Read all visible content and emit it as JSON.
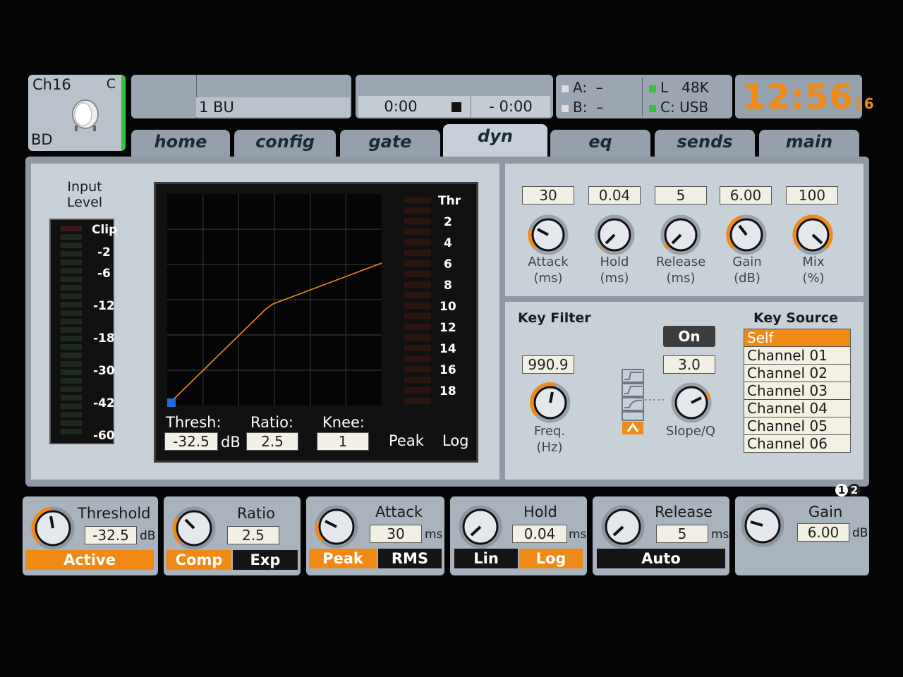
{
  "channel": {
    "name": "Ch16",
    "corner": "C",
    "short": "BD"
  },
  "header": {
    "channel_label": "1 BU",
    "time_elapsed": "0:00",
    "time_remaining": "- 0:00",
    "io": {
      "a_label": "A:",
      "a_value": "–",
      "b_label": "B:",
      "b_value": "–",
      "l_label": "L",
      "rate": "48K",
      "c_label": "C:",
      "c_value": "USB"
    },
    "clock": {
      "hm": "12:56",
      "sec": "16"
    }
  },
  "tabs": [
    "home",
    "config",
    "gate",
    "dyn",
    "eq",
    "sends",
    "main"
  ],
  "active_tab": "dyn",
  "input_meter": {
    "title_line1": "Input",
    "title_line2": "Level",
    "labels": [
      "Clip",
      "-2",
      "-6",
      "-12",
      "-18",
      "-30",
      "-42",
      "-60"
    ]
  },
  "graph": {
    "gr_labels": [
      "Thr",
      "2",
      "4",
      "6",
      "8",
      "10",
      "12",
      "14",
      "16",
      "18"
    ],
    "thresh_label": "Thresh:",
    "thresh_value": "-32.5",
    "thresh_unit": "dB",
    "ratio_label": "Ratio:",
    "ratio_value": "2.5",
    "knee_label": "Knee:",
    "knee_value": "1",
    "mode_peak": "Peak",
    "mode_log": "Log"
  },
  "params": [
    {
      "value": "30",
      "label1": "Attack",
      "label2": "(ms)"
    },
    {
      "value": "0.04",
      "label1": "Hold",
      "label2": "(ms)"
    },
    {
      "value": "5",
      "label1": "Release",
      "label2": "(ms)"
    },
    {
      "value": "6.00",
      "label1": "Gain",
      "label2": "(dB)"
    },
    {
      "value": "100",
      "label1": "Mix",
      "label2": "(%)"
    }
  ],
  "key_filter": {
    "title": "Key Filter",
    "freq_value": "990.9",
    "freq_label1": "Freq.",
    "freq_label2": "(Hz)",
    "on_label": "On",
    "slope_value": "3.0",
    "slope_label": "Slope/Q"
  },
  "key_source": {
    "title": "Key Source",
    "items": [
      "Self",
      "Channel 01",
      "Channel 02",
      "Channel 03",
      "Channel 04",
      "Channel 05",
      "Channel 06"
    ]
  },
  "page_indicator": [
    "1",
    "2"
  ],
  "bottom": {
    "threshold": {
      "label": "Threshold",
      "value": "-32.5",
      "unit": "dB",
      "button": "Active"
    },
    "ratio": {
      "label": "Ratio",
      "value": "2.5",
      "btn_a": "Comp",
      "btn_b": "Exp"
    },
    "attack": {
      "label": "Attack",
      "value": "30",
      "unit": "ms",
      "btn_a": "Peak",
      "btn_b": "RMS"
    },
    "hold": {
      "label": "Hold",
      "value": "0.04",
      "unit": "ms",
      "btn_a": "Lin",
      "btn_b": "Log"
    },
    "release": {
      "label": "Release",
      "value": "5",
      "unit": "ms",
      "button": "Auto"
    },
    "gain": {
      "label": "Gain",
      "value": "6.00",
      "unit": "dB"
    }
  },
  "colors": {
    "accent": "#f08a14",
    "green": "#36c23b",
    "blue": "#1e6fd9"
  },
  "icons": [
    "kick-drum-icon",
    "stop-icon",
    "filter-type-icons"
  ]
}
